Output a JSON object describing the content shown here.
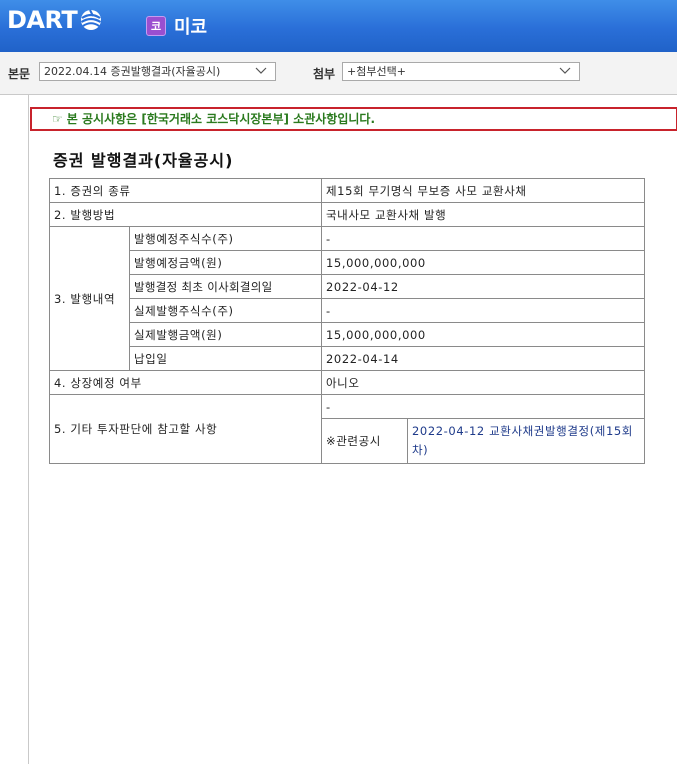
{
  "header": {
    "logo_text": "DART",
    "company_badge": "코",
    "company_name": "미코",
    "colors": {
      "bar": "#2a6fd8",
      "badge": "#9a4fd0"
    }
  },
  "toolbar": {
    "main_label": "본문",
    "main_select_value": "2022.04.14  증권발행결과(자율공시)",
    "attach_label": "첨부",
    "attach_select_value": "+첨부선택+"
  },
  "notice": {
    "icon": "hand-pointing-icon",
    "text": "본 공시사항은 [한국거래소 코스닥시장본부] 소관사항입니다.",
    "colors": {
      "border": "#c8232c",
      "text": "#2a7a1e"
    }
  },
  "document": {
    "title": "증권 발행결과(자율공시)",
    "rows": {
      "r1": {
        "label": "1. 증권의 종류",
        "value": "제15회 무기명식 무보증 사모 교환사채"
      },
      "r2": {
        "label": "2. 발행방법",
        "value": "국내사모 교환사채 발행"
      },
      "r3": {
        "label": "3. 발행내역",
        "sub": [
          {
            "label": "발행예정주식수(주)",
            "value": "-"
          },
          {
            "label": "발행예정금액(원)",
            "value": "15,000,000,000"
          },
          {
            "label": "발행결정 최초 이사회결의일",
            "value": "2022-04-12"
          },
          {
            "label": "실제발행주식수(주)",
            "value": "-"
          },
          {
            "label": "실제발행금액(원)",
            "value": "15,000,000,000"
          },
          {
            "label": "납입일",
            "value": "2022-04-14"
          }
        ]
      },
      "r4": {
        "label": "4. 상장예정 여부",
        "value": "아니오"
      },
      "r5": {
        "label": "5. 기타 투자판단에 참고할 사항",
        "value": "-",
        "related_label": "※관련공시",
        "related_link": "2022-04-12 교환사채권발행결정(제15회차)"
      }
    }
  }
}
